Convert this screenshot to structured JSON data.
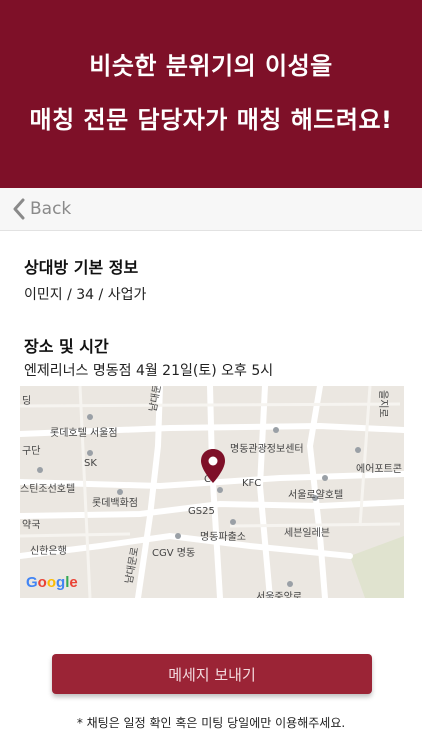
{
  "banner": {
    "line1": "비슷한 분위기의 이성을",
    "line2": "매칭 전문 담당자가 매칭 해드려요!"
  },
  "nav": {
    "back_label": "Back"
  },
  "partner": {
    "title": "상대방 기본 정보",
    "info": "이민지 / 34 / 사업가"
  },
  "venue": {
    "title": "장소 및 시간",
    "details": "엔제리너스 명동점 4월 21일(토) 오후 5시"
  },
  "map": {
    "labels": {
      "building": "딩",
      "lotte_hotel_seoul": "롯데호텔 서울점",
      "gu": "구단",
      "sk": "SK",
      "myeongdong_tourist_center": "명동관광정보센터",
      "airport": "에어포트콘",
      "westin": "스틴조선호텔",
      "kfc": "KFC",
      "seoul_royal_hotel": "서울로얄호텔",
      "lotte_dept": "롯데백화점",
      "gs25": "GS25",
      "seven_eleven": "세븐일레븐",
      "pharmacy": "약국",
      "shinhan": "신한은행",
      "cgv": "CGV 명동",
      "police": "명동파출소",
      "namdaemun_road": "남대문로",
      "namdaemun_road2": "남대문로",
      "right_road": "을지로",
      "bottom_label": "서울중앙로",
      "c": "C"
    },
    "google": "Google"
  },
  "actions": {
    "send_label": "메세지 보내기"
  },
  "note": "* 채팅은 일정 확인 혹은 미팅 당일에만 이용해주세요.",
  "colors": {
    "brand": "#7e1028",
    "button": "#9b2436"
  }
}
